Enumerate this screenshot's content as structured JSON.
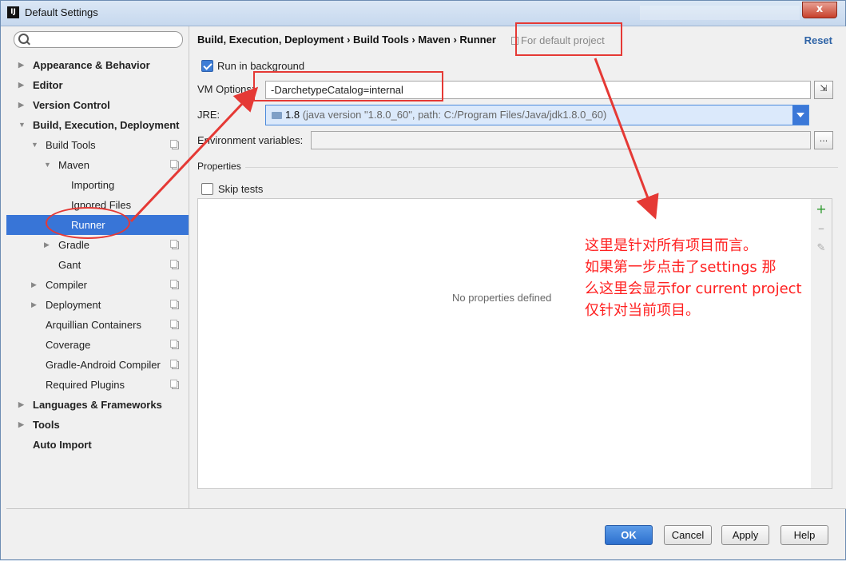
{
  "window": {
    "title": "Default Settings",
    "app_icon": "intellij-icon",
    "close_glyph": "x"
  },
  "sidebar": {
    "search_placeholder": "",
    "items": [
      {
        "label": "Appearance & Behavior",
        "expanded": false
      },
      {
        "label": "Editor",
        "expanded": false
      },
      {
        "label": "Version Control",
        "expanded": false
      },
      {
        "label": "Build, Execution, Deployment",
        "expanded": true
      },
      {
        "label": "Build Tools",
        "expanded": true
      },
      {
        "label": "Maven",
        "expanded": true
      },
      {
        "label": "Importing"
      },
      {
        "label": "Ignored Files"
      },
      {
        "label": "Runner",
        "selected": true
      },
      {
        "label": "Gradle",
        "expanded": false
      },
      {
        "label": "Gant"
      },
      {
        "label": "Compiler",
        "expanded": false
      },
      {
        "label": "Deployment",
        "expanded": false
      },
      {
        "label": "Arquillian Containers"
      },
      {
        "label": "Coverage"
      },
      {
        "label": "Gradle-Android Compiler"
      },
      {
        "label": "Required Plugins"
      },
      {
        "label": "Languages & Frameworks",
        "expanded": false
      },
      {
        "label": "Tools",
        "expanded": false
      },
      {
        "label": "Auto Import"
      }
    ]
  },
  "main": {
    "breadcrumb": "Build, Execution, Deployment › Build Tools › Maven › Runner",
    "scope": "For default project",
    "reset": "Reset",
    "run_in_background": {
      "label": "Run in background",
      "checked": true
    },
    "vm_options": {
      "label": "VM Options:",
      "value": "-DarchetypeCatalog=internal"
    },
    "jre": {
      "label": "JRE:",
      "version": "1.8",
      "detail": "(java version \"1.8.0_60\", path: C:/Program Files/Java/jdk1.8.0_60)"
    },
    "env": {
      "label": "Environment variables:",
      "value": "",
      "button": "..."
    },
    "properties": {
      "title": "Properties",
      "skip_tests": {
        "label": "Skip tests",
        "checked": false
      },
      "empty_text": "No properties defined"
    }
  },
  "buttons": {
    "ok": "OK",
    "cancel": "Cancel",
    "apply": "Apply",
    "help": "Help"
  },
  "annotation": {
    "lines": [
      "这里是针对所有项目而言。",
      "如果第一步点击了settings 那",
      "么这里会显示for current project",
      "仅针对当前项目。"
    ],
    "color": "#ff2020"
  }
}
